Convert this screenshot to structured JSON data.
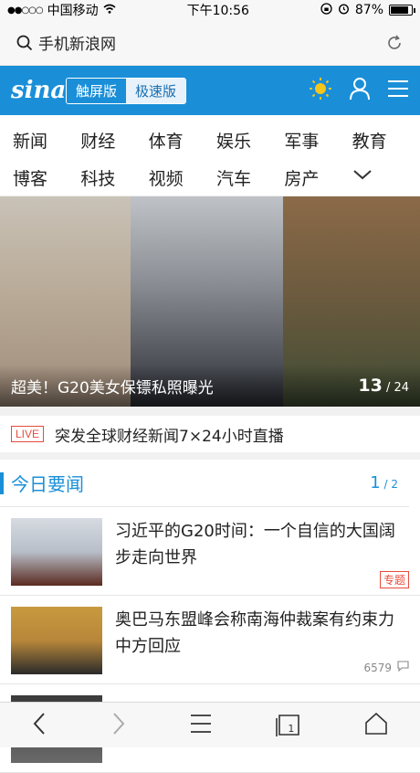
{
  "status_bar": {
    "signal_dots": "●●○○○",
    "carrier": "中国移动",
    "time": "下午10:56",
    "battery": "87%",
    "battery_level": 0.87
  },
  "url_bar": {
    "query": "手机新浪网"
  },
  "header": {
    "logo": "sina",
    "mode_touch": "触屏版",
    "mode_fast": "极速版"
  },
  "nav": {
    "items": [
      "新闻",
      "财经",
      "体育",
      "娱乐",
      "军事",
      "教育",
      "博客",
      "科技",
      "视频",
      "汽车",
      "房产"
    ]
  },
  "carousel": {
    "caption": "超美！G20美女保镖私照曝光",
    "current": "13",
    "total": "/ 24"
  },
  "live": {
    "badge": "LIVE",
    "text": "突发全球财经新闻7×24小时直播"
  },
  "section": {
    "title": "今日要闻",
    "page_current": "1",
    "page_total": "/ 2"
  },
  "news": [
    {
      "title": "习近平的G20时间：一个自信的大国阔步走向世界",
      "tag": "专题",
      "count": ""
    },
    {
      "title": "奥巴马东盟峰会称南海仲裁案有约束力中方回应",
      "tag": "",
      "count": "6579"
    },
    {
      "title": "",
      "tag": "",
      "count": ""
    }
  ],
  "toolbar": {
    "tabs_count": "1"
  },
  "colors": {
    "brand": "#1a8fd8",
    "live_red": "#e74c3c"
  }
}
